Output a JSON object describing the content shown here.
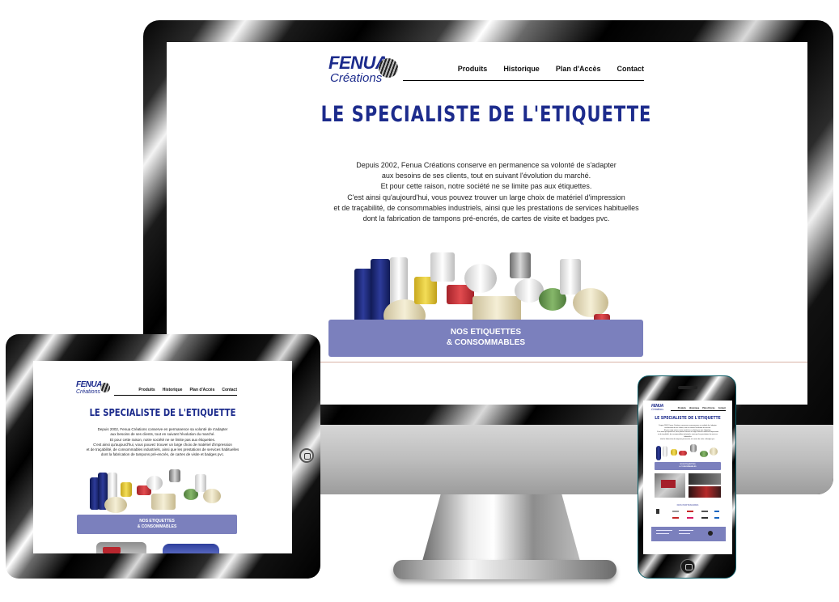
{
  "site": {
    "logo": {
      "top": "FENUA",
      "bottom": "Créations"
    },
    "nav": [
      "Produits",
      "Historique",
      "Plan d'Accès",
      "Contact"
    ],
    "headline": "LE SPECIALISTE DE L'ETIQUETTE",
    "intro": [
      "Depuis 2002, Fenua Créations conserve en permanence sa volonté de s'adapter",
      "aux besoins de ses clients, tout en suivant l'évolution du marché.",
      "Et pour cette raison, notre société ne se limite pas aux étiquettes.",
      "C'est ainsi qu'aujourd'hui, vous pouvez trouver un large choix de matériel d'impression",
      "et de traçabilité, de consommables industriels, ainsi que les prestations de services habituelles",
      "dont la fabrication de tampons pré-encrés, de cartes de visite et badges pvc."
    ],
    "banner": {
      "line1": "NOS ETIQUETTES",
      "line2": "& CONSOMMABLES"
    }
  },
  "phone": {
    "partners_heading": "NOS PARTENAIRES"
  },
  "colors": {
    "brand": "#1c2b8c",
    "banner": "#7b80bd",
    "accent_line": "#d9b3a7"
  }
}
